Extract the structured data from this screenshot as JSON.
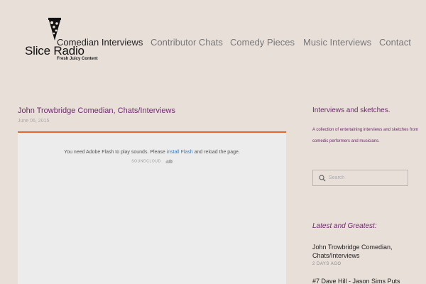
{
  "header": {
    "logo_title": "Slice Radio",
    "logo_tagline": "Fresh Juicy Content",
    "nav": [
      {
        "label": "Comedian Interviews"
      },
      {
        "label": "Contributor Chats"
      },
      {
        "label": "Comedy Pieces"
      },
      {
        "label": "Music Interviews"
      },
      {
        "label": "Contact"
      }
    ]
  },
  "post": {
    "title": "John Trowbridge Comedian, Chats/Interviews",
    "date": "June 06, 2015",
    "player": {
      "message_before": "You need Adobe Flash to play sounds. Please ",
      "link_label": "install Flash",
      "message_after": " and reload the page.",
      "brand": "SOUNDCLOUD"
    }
  },
  "sidebar": {
    "heading": "Interviews and sketches.",
    "description": "A collection of entertaining interviews and sketches from comedic performers and musicians.",
    "search_placeholder": "Search",
    "latest_heading": "Latest and Greatest:",
    "latest": [
      {
        "title": "John Trowbridge Comedian, Chats/Interviews",
        "meta": "2 DAYS AGO"
      },
      {
        "title": "#7 Dave Hill - Jason Sims Puts",
        "meta": ""
      }
    ]
  },
  "colors": {
    "background": "#e8dfd9",
    "accent_purple": "#6e2a6e",
    "player_border": "#e0692f",
    "link_blue": "#3b7bbf"
  },
  "icons": {
    "logo": "pizza-slice-icon",
    "search": "search-icon",
    "soundcloud": "cloud-icon"
  }
}
